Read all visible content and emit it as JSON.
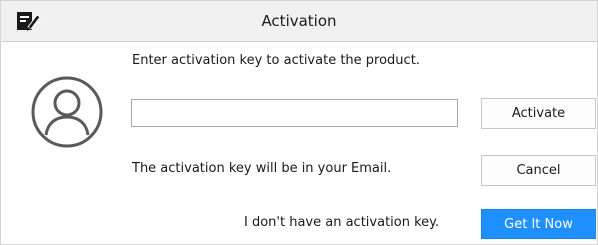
{
  "window": {
    "title": "Activation"
  },
  "dialog": {
    "prompt": "Enter activation key to activate the product.",
    "key_input": {
      "value": "",
      "placeholder": ""
    },
    "info_text": "The activation key will be in your Email.",
    "no_key_text": "I don't have an activation key."
  },
  "buttons": {
    "activate_label": "Activate",
    "cancel_label": "Cancel",
    "get_it_now_label": "Get It Now"
  },
  "icons": {
    "app": "app-logo-icon",
    "avatar": "user-avatar-icon"
  },
  "colors": {
    "primary_button": "#1e90ff",
    "titlebar": "#f0f0f0"
  }
}
